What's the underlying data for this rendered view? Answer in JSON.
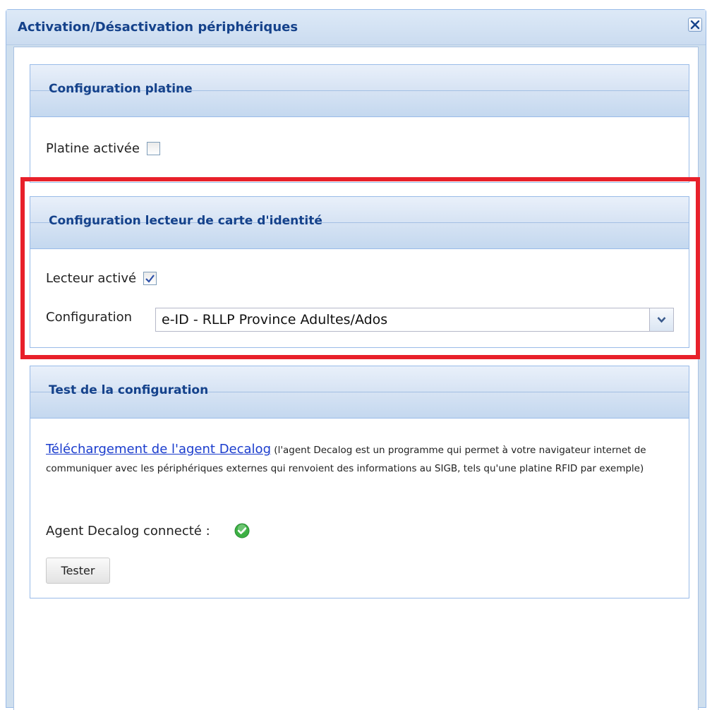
{
  "dialog": {
    "title": "Activation/Désactivation périphériques",
    "close_icon": "close-icon"
  },
  "platine_section": {
    "title": "Configuration platine",
    "checkbox_label": "Platine activée",
    "checked": false
  },
  "lecteur_section": {
    "title": "Configuration lecteur de carte d'identité",
    "checkbox_label": "Lecteur activé",
    "checked": true,
    "config_label": "Configuration",
    "config_value": "e-ID - RLLP Province Adultes/Ados"
  },
  "test_section": {
    "title": "Test de la configuration",
    "download_link": "Téléchargement de l'agent Decalog",
    "description": "(l'agent Decalog est un programme qui permet à votre navigateur internet de communiquer avec les périphériques externes qui renvoient des informations au SIGB, tels qu'une platine RFID par exemple)",
    "agent_status_label": "Agent Decalog connecté :",
    "agent_connected": true,
    "tester_button": "Tester"
  },
  "colors": {
    "header_text": "#15428b",
    "highlight_border": "#e8202a",
    "link": "#1a3ccd",
    "status_ok": "#3cb043"
  }
}
